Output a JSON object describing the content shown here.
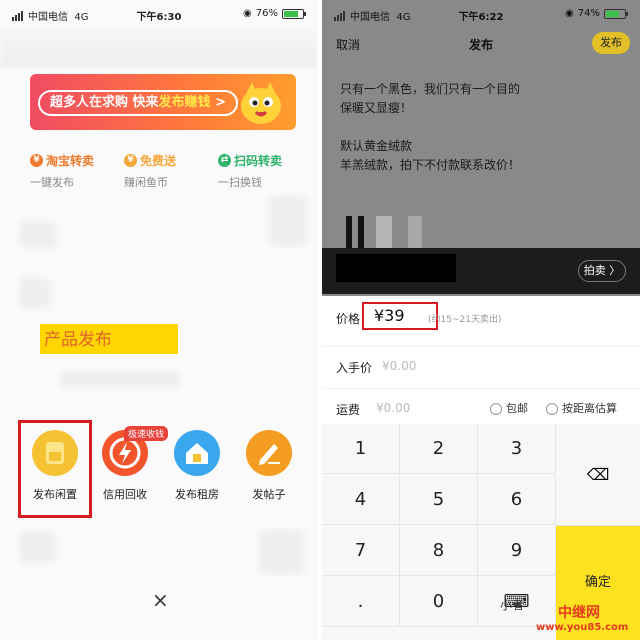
{
  "left": {
    "status": {
      "carrier": "中国电信",
      "network": "4G",
      "time": "下午6:30",
      "battery": "76%"
    },
    "banner": {
      "text_a": "超多人在求购 快来",
      "text_b": "发布赚钱",
      "arrow": ">"
    },
    "shortcuts": [
      {
        "title": "淘宝转卖",
        "sub": "一键发布",
        "color": "#f07b2e",
        "glyph": "¥"
      },
      {
        "title": "免费送",
        "sub": "赚闲鱼币",
        "color": "#f7a73a",
        "glyph": "¥"
      },
      {
        "title": "扫码转卖",
        "sub": "一扫换钱",
        "color": "#2fb36b",
        "glyph": "⇄"
      }
    ],
    "highlight_label": "产品发布",
    "launch_items": [
      {
        "label": "发布闲置",
        "color": "#f5c234"
      },
      {
        "label": "信用回收",
        "color": "#f2542b"
      },
      {
        "label": "发布租房",
        "color": "#3ba7ee"
      },
      {
        "label": "发帖子",
        "color": "#f59c22"
      }
    ],
    "tag": "极速收钱",
    "close": "×"
  },
  "right": {
    "status": {
      "carrier": "中国电信",
      "network": "4G",
      "time": "下午6:22",
      "battery": "74%"
    },
    "nav": {
      "cancel": "取消",
      "title": "发布",
      "publish": "发布"
    },
    "desc_lines": [
      "只有一个黑色，我们只有一个目的",
      "保暖又显瘦！",
      "",
      "默认黄金绒款",
      "羊羔绒款，拍下不付款联系改价！"
    ],
    "paimai": "拍卖 〉",
    "price": {
      "label": "价格",
      "value": "¥39",
      "hint": "(约15~21天卖出)"
    },
    "cost": {
      "label": "入手价",
      "value": "¥0.00"
    },
    "shipping": {
      "label": "运费",
      "value": "¥0.00",
      "opt1": "包邮",
      "opt2": "按距离估算"
    },
    "keys": [
      "1",
      "2",
      "3",
      "4",
      "5",
      "6",
      "7",
      "8",
      "9",
      ".",
      "0",
      "⌨"
    ],
    "confirm": "确定",
    "delete_glyph": "⌫"
  },
  "watermark": {
    "text": "小者",
    "logo": "中继网",
    "url": "www.you85.com"
  }
}
